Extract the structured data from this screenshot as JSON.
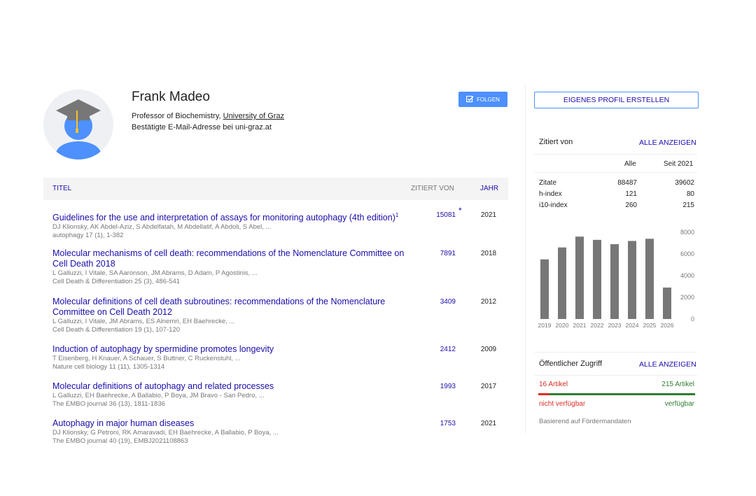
{
  "profile": {
    "name": "Frank Madeo",
    "affiliation_prefix": "Professor of Biochemistry, ",
    "affiliation_link": "University of Graz",
    "email": "Bestätigte E-Mail-Adresse bei uni-graz.at",
    "follow_label": "FOLGEN"
  },
  "table": {
    "header_title": "TITEL",
    "header_cited": "ZITIERT VON",
    "header_year": "JAHR",
    "rows": [
      {
        "title": "Guidelines for the use and interpretation of assays for monitoring autophagy (4th edition)",
        "sup": "1",
        "authors": "DJ Klionsky, AK Abdel-Aziz, S Abdelfatah, M Abdellatif, A Abdoli, S Abel, ...",
        "journal": "autophagy 17 (1), 1-382",
        "cited": "15081",
        "star": "*",
        "year": "2021"
      },
      {
        "title": "Molecular mechanisms of cell death: recommendations of the Nomenclature Committee on Cell Death 2018",
        "authors": "L Galluzzi, I Vitale, SA Aaronson, JM Abrams, D Adam, P Agostinis, ...",
        "journal": "Cell Death & Differentiation 25 (3), 486-541",
        "cited": "7891",
        "year": "2018"
      },
      {
        "title": "Molecular definitions of cell death subroutines: recommendations of the Nomenclature Committee on Cell Death 2012",
        "authors": "L Galluzzi, I Vitale, JM Abrams, ES Alnemri, EH Baehrecke, ...",
        "journal": "Cell Death & Differentiation 19 (1), 107-120",
        "cited": "3409",
        "year": "2012"
      },
      {
        "title": "Induction of autophagy by spermidine promotes longevity",
        "authors": "T Eisenberg, H Knauer, A Schauer, S Buttner, C Ruckenstuhl, ...",
        "journal": "Nature cell biology 11 (11), 1305-1314",
        "cited": "2412",
        "year": "2009"
      },
      {
        "title": "Molecular definitions of autophagy and related processes",
        "authors": "L Galluzzi, EH Baehrecke, A Ballabio, P Boya, JM Bravo - San Pedro, ...",
        "journal": "The EMBO journal 36 (13), 1811-1836",
        "cited": "1993",
        "year": "2017"
      },
      {
        "title": "Autophagy in major human diseases",
        "authors": "DJ Klionsky, G Petroni, RK Amaravadi, EH Baehrecke, A Ballabio, P Boya, ...",
        "journal": "The EMBO journal 40 (19), EMBJ2021108863",
        "cited": "1753",
        "year": "2021"
      }
    ]
  },
  "sidebar": {
    "create_profile": "EIGENES PROFIL ERSTELLEN",
    "cited_by_label": "Zitiert von",
    "show_all": "ALLE ANZEIGEN",
    "col_all": "Alle",
    "col_since": "Seit 2021",
    "stats": [
      {
        "label": "Zitate",
        "all": "88487",
        "since": "39602"
      },
      {
        "label": "h-index",
        "all": "121",
        "since": "80"
      },
      {
        "label": "i10-index",
        "all": "260",
        "since": "215"
      }
    ],
    "access_label": "Öffentlicher Zugriff",
    "access_show_all": "ALLE ANZEIGEN",
    "unavailable_count": "16 Artikel",
    "available_count": "215 Artikel",
    "unavailable_label": "nicht verfügbar",
    "available_label": "verfügbar",
    "mandates_note": "Basierend auf Fördermandaten",
    "colors": {
      "unavailable": "#d93025",
      "available": "#2e7d32",
      "bar": "#777777"
    }
  },
  "chart_data": {
    "type": "bar",
    "categories": [
      "2019",
      "2020",
      "2021",
      "2022",
      "2023",
      "2024",
      "2025",
      "2026"
    ],
    "values": [
      5500,
      6600,
      7600,
      7300,
      6900,
      7200,
      7400,
      2900
    ],
    "y_ticks": [
      "8000",
      "6000",
      "4000",
      "2000",
      "0"
    ],
    "ylim": [
      0,
      8000
    ],
    "grid": false
  }
}
